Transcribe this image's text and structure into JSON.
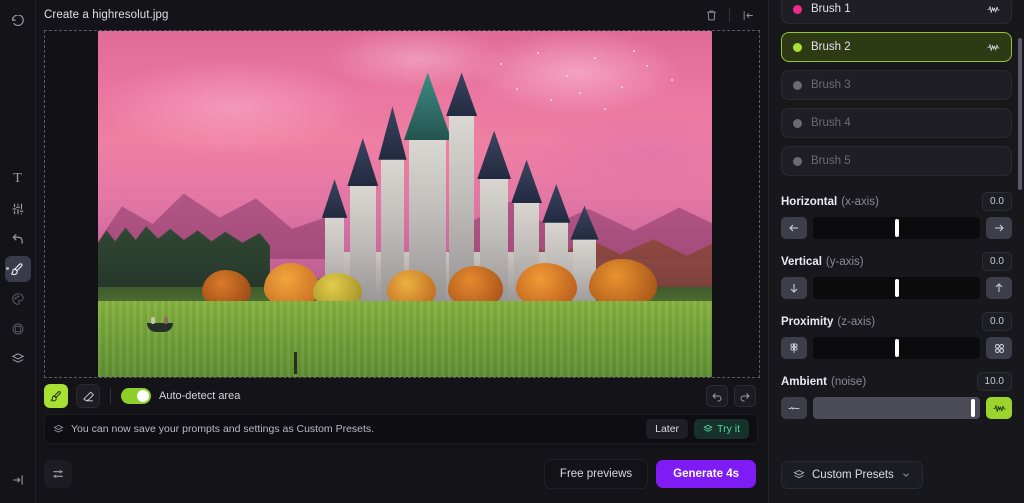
{
  "app": {
    "accent_green": "#a8e033",
    "accent_purple": "#7f1bf5",
    "accent_teal": "#55d6a8",
    "panel_bg": "#17171c"
  },
  "left_rail": {
    "items": [
      {
        "name": "history-icon",
        "label": "History",
        "glyph": "undo"
      },
      {
        "name": "text-tool",
        "label": "Text",
        "glyph": "T"
      },
      {
        "name": "adjustments-tool",
        "label": "Adjustments",
        "glyph": "sliders"
      },
      {
        "name": "transform-tool",
        "label": "Transform",
        "glyph": "arrow"
      },
      {
        "name": "brush-tool",
        "label": "Brush",
        "glyph": "brush"
      },
      {
        "name": "color-tool",
        "label": "Color",
        "glyph": "palette"
      },
      {
        "name": "shape-tool",
        "label": "Shape",
        "glyph": "shape"
      },
      {
        "name": "layers-tool",
        "label": "Layers",
        "glyph": "layers"
      },
      {
        "name": "expand-panel",
        "label": "Expand",
        "glyph": "expand"
      }
    ]
  },
  "canvas": {
    "title": "Create a highresolut.jpg",
    "delete_label": "Delete",
    "collapse_label": "Collapse panel",
    "artwork_alt": "Fantasy castle over a green lake at pink sunset"
  },
  "toolstrip": {
    "brush_label": "Brush",
    "eraser_label": "Eraser",
    "autodetect_label": "Auto-detect area",
    "autodetect_on": true,
    "undo_label": "Undo",
    "redo_label": "Redo"
  },
  "notice": {
    "text": "You can now save your prompts and settings as Custom Presets.",
    "later_label": "Later",
    "try_label": "Try it"
  },
  "actionbar": {
    "settings_label": "Settings",
    "free_previews_label": "Free previews",
    "generate_label": "Generate 4s"
  },
  "brushes": [
    {
      "label": "Brush 1",
      "color": "#f0298f",
      "active": false,
      "enabled": true
    },
    {
      "label": "Brush 2",
      "color": "#a8e033",
      "active": true,
      "enabled": true
    },
    {
      "label": "Brush 3",
      "color": "#6a6a75",
      "active": false,
      "enabled": false
    },
    {
      "label": "Brush 4",
      "color": "#6a6a75",
      "active": false,
      "enabled": false
    },
    {
      "label": "Brush 5",
      "color": "#6a6a75",
      "active": false,
      "enabled": false
    }
  ],
  "sliders": [
    {
      "name": "Horizontal",
      "axis": "(x-axis)",
      "value": "0.0",
      "pos": 50,
      "left_icon": "arrow-left",
      "right_icon": "arrow-right",
      "filled": false,
      "right_green": false
    },
    {
      "name": "Vertical",
      "axis": "(y-axis)",
      "value": "0.0",
      "pos": 50,
      "left_icon": "arrow-down",
      "right_icon": "arrow-up",
      "filled": false,
      "right_green": false
    },
    {
      "name": "Proximity",
      "axis": "(z-axis)",
      "value": "0.0",
      "pos": 50,
      "left_icon": "grid-small",
      "right_icon": "grid-large",
      "filled": false,
      "right_green": false
    },
    {
      "name": "Ambient",
      "axis": "(noise)",
      "value": "10.0",
      "pos": 96,
      "left_icon": "wave-flat",
      "right_icon": "wave-active",
      "filled": true,
      "right_green": true
    }
  ],
  "presets": {
    "label": "Custom Presets"
  }
}
